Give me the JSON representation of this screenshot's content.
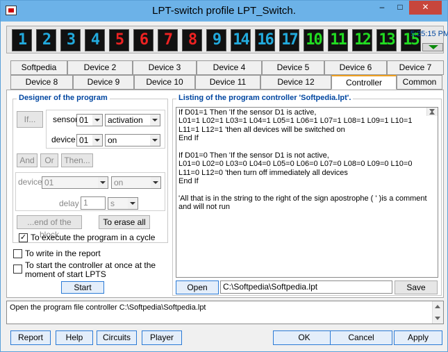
{
  "window": {
    "title": "LPT-switch profile LPT_Switch.",
    "minimize_glyph": "–",
    "maximize_glyph": "□",
    "close_glyph": "✕"
  },
  "leds": [
    {
      "label": "1",
      "color": "#22aadd"
    },
    {
      "label": "2",
      "color": "#22aadd"
    },
    {
      "label": "3",
      "color": "#22aadd"
    },
    {
      "label": "4",
      "color": "#22aadd"
    },
    {
      "label": "5",
      "color": "#ee2222"
    },
    {
      "label": "6",
      "color": "#ee2222"
    },
    {
      "label": "7",
      "color": "#ee2222"
    },
    {
      "label": "8",
      "color": "#ee2222"
    },
    {
      "label": "9",
      "color": "#22aadd"
    },
    {
      "label": "14",
      "color": "#22aadd"
    },
    {
      "label": "16",
      "color": "#22aadd"
    },
    {
      "label": "17",
      "color": "#22aadd"
    },
    {
      "label": "10",
      "color": "#22dd22"
    },
    {
      "label": "11",
      "color": "#22dd22"
    },
    {
      "label": "12",
      "color": "#22dd22"
    },
    {
      "label": "13",
      "color": "#22dd22"
    },
    {
      "label": "15",
      "color": "#22dd22"
    }
  ],
  "clock": "5:25:15 PM",
  "tabs_row1": [
    "Softpedia",
    "Device 2",
    "Device 3",
    "Device 4",
    "Device 5",
    "Device 6",
    "Device 7"
  ],
  "tabs_row2": [
    "Device 8",
    "Device 9",
    "Device 10",
    "Device 11",
    "Device 12",
    "Controller",
    "Common"
  ],
  "active_tab": "Controller",
  "designer": {
    "title": "Designer of the program",
    "if_label": "If...",
    "sensor_label": "sensor",
    "sensor_value": "01",
    "sensor_state": "activation",
    "device_label": "device",
    "device_value": "01",
    "device_state": "on",
    "and_label": "And",
    "or_label": "Or",
    "then_label": "Then...",
    "device2_label": "device",
    "device2_value": "01",
    "device2_state": "on",
    "delay_label": "delay",
    "delay_value": "1",
    "delay_unit": "s",
    "end_block_label": "...end of the block",
    "erase_label": "To erase all",
    "cycle_label": "To execute the program in a cycle",
    "cycle_checked": "✓"
  },
  "options": {
    "report_label": "To write in the report",
    "start_label_1": "To start the controller at once at the",
    "start_label_2": "moment of start LPTS",
    "start_button": "Start"
  },
  "listing": {
    "title": "Listing of the program controller 'Softpedia.lpt'.",
    "lines": [
      "If D01=1 Then 'If the sensor D1 is active,",
      "L01=1 L02=1 L03=1 L04=1 L05=1 L06=1 L07=1 L08=1 L09=1 L10=1",
      "L11=1 L12=1 'then all devices will be switched on",
      "End If",
      "",
      "If D01=0 Then 'If the sensor D1 is not active,",
      "L01=0 L02=0 L03=0 L04=0 L05=0 L06=0 L07=0 L08=0 L09=0 L10=0",
      "L11=0 L12=0 'then turn off immediately all devices",
      "End If",
      "",
      "'All that is in the string to the right of the sign apostrophe ( ' )is a comment",
      "and will not run"
    ],
    "open_label": "Open",
    "path_value": "C:\\Softpedia\\Softpedia.lpt",
    "save_label": "Save"
  },
  "status_message": "Open the program file controller C:\\Softpedia\\Softpedia.lpt",
  "bottom": {
    "report": "Report",
    "help": "Help",
    "circuits": "Circuits",
    "player": "Player",
    "ok": "OK",
    "cancel": "Cancel",
    "apply": "Apply"
  }
}
